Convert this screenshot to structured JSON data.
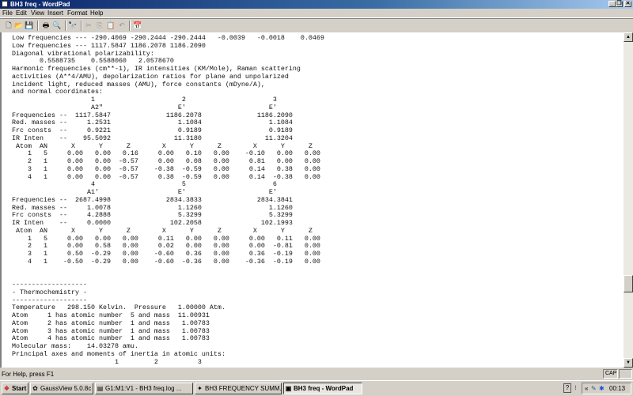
{
  "window": {
    "title": "BH3 freq - WordPad",
    "minimize_icon": "_",
    "maximize_icon": "❐",
    "close_icon": "✕"
  },
  "menu": [
    "File",
    "Edit",
    "View",
    "Insert",
    "Format",
    "Help"
  ],
  "toolbar": {
    "new_icon": "🗋",
    "open_icon": "📂",
    "save_icon": "💾",
    "print_icon": "🖶",
    "print_preview_icon": "🔍",
    "find_icon": "🔭",
    "cut_icon": "✂",
    "copy_icon": "⎘",
    "paste_icon": "📋",
    "undo_icon": "↶",
    "datetime_icon": "📅"
  },
  "document": {
    "lines": [
      "Low frequencies --- -290.4069 -290.2444 -290.2444   -0.0039   -0.0018    0.0469",
      "Low frequencies --- 1117.5847 1186.2078 1186.2090",
      "Diagonal vibrational polarizability:",
      "       0.5588735    0.5588060   2.0578670",
      "Harmonic frequencies (cm**-1), IR intensities (KM/Mole), Raman scattering",
      "activities (A**4/AMU), depolarization ratios for plane and unpolarized",
      "incident light, reduced masses (AMU), force constants (mDyne/A),",
      "and normal coordinates:",
      "                    1                      2                      3",
      "                    A2\"                   E'                     E'",
      "Frequencies --  1117.5847              1186.2078              1186.2090",
      "Red. masses --     1.2531                 1.1084                 1.1084",
      "Frc consts  --     0.9221                 0.9189                 0.9189",
      "IR Inten    --    95.5092                11.3180                11.3204",
      " Atom  AN      X      Y      Z        X      Y      Z        X      Y      Z",
      "    1   5     0.00   0.00   0.16     0.00   0.10   0.00    -0.10   0.00   0.00",
      "    2   1     0.00   0.00  -0.57     0.00   0.08   0.00     0.81   0.00   0.00",
      "    3   1     0.00   0.00  -0.57    -0.38  -0.59   0.00     0.14   0.38   0.00",
      "    4   1     0.00   0.00  -0.57     0.38  -0.59   0.00     0.14  -0.38   0.00",
      "                    4                      5                      6",
      "                   A1'                    E'                     E'",
      "Frequencies --  2687.4998              2834.3833              2834.3841",
      "Red. masses --     1.0078                 1.1260                 1.1260",
      "Frc consts  --     4.2888                 5.3299                 5.3299",
      "IR Inten    --     0.0000               102.2058               102.1993",
      " Atom  AN      X      Y      Z        X      Y      Z        X      Y      Z",
      "    1   5     0.00   0.00   0.00     0.11   0.00   0.00     0.00   0.11   0.00",
      "    2   1     0.00   0.58   0.00     0.02   0.00   0.00     0.00  -0.81   0.00",
      "    3   1     0.50  -0.29   0.00    -0.60   0.36   0.00     0.36  -0.19   0.00",
      "    4   1    -0.50  -0.29   0.00    -0.60  -0.36   0.00    -0.36  -0.19   0.00",
      "",
      "",
      "-------------------",
      "- Thermochemistry -",
      "-------------------",
      "Temperature   298.150 Kelvin.  Pressure   1.00000 Atm.",
      "Atom     1 has atomic number  5 and mass  11.00931",
      "Atom     2 has atomic number  1 and mass   1.00783",
      "Atom     3 has atomic number  1 and mass   1.00783",
      "Atom     4 has atomic number  1 and mass   1.00783",
      "Molecular mass:    14.03278 amu.",
      "Principal axes and moments of inertia in atomic units:",
      "                          1         2          3"
    ]
  },
  "scrollbar": {
    "up_icon": "▲",
    "down_icon": "▼",
    "position_fraction": 0.78
  },
  "statusbar": {
    "help_text": "For Help, press F1",
    "caps_indicator": "CAP"
  },
  "taskbar": {
    "start_label": "Start",
    "tasks": [
      {
        "label": "GaussView 5.0.8c",
        "icon": "✿"
      },
      {
        "label": "G1:M1:V1 - BH3 freq.log ...",
        "icon": "▤"
      },
      {
        "label": "BH3 FREQUENCY SUMM...",
        "icon": "✦"
      },
      {
        "label": "BH3 freq - WordPad",
        "icon": "▣"
      }
    ],
    "tray": {
      "help_icon": "?",
      "expand_icon": "«",
      "clock": "00:13"
    }
  }
}
